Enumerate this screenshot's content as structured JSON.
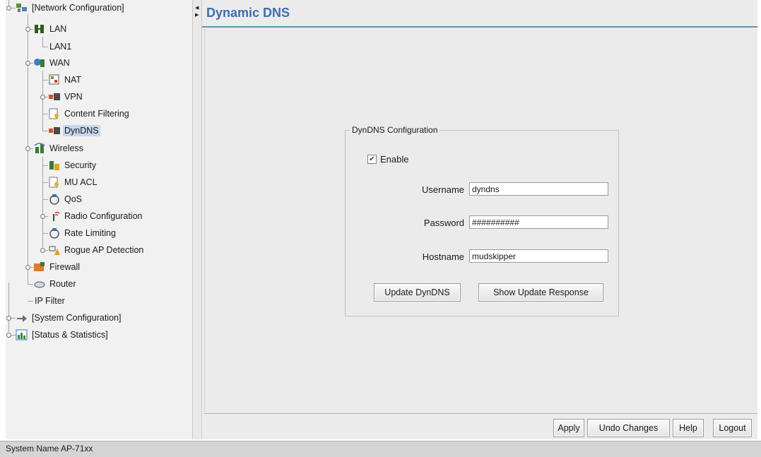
{
  "tree": {
    "items": [
      {
        "label": "[Network Configuration]",
        "icon": "network-config-icon"
      },
      {
        "label": "LAN",
        "icon": "lan-icon"
      },
      {
        "label": "LAN1",
        "icon": ""
      },
      {
        "label": "WAN",
        "icon": "wan-icon"
      },
      {
        "label": "NAT",
        "icon": "nat-icon"
      },
      {
        "label": "VPN",
        "icon": "vpn-icon"
      },
      {
        "label": "Content Filtering",
        "icon": "content-filtering-icon"
      },
      {
        "label": "DynDNS",
        "icon": "dyndns-icon"
      },
      {
        "label": "Wireless",
        "icon": "wireless-icon"
      },
      {
        "label": "Security",
        "icon": "security-icon"
      },
      {
        "label": "MU ACL",
        "icon": "mu-acl-icon"
      },
      {
        "label": "QoS",
        "icon": "qos-icon"
      },
      {
        "label": "Radio Configuration",
        "icon": "radio-config-icon"
      },
      {
        "label": "Rate Limiting",
        "icon": "rate-limiting-icon"
      },
      {
        "label": "Rogue AP Detection",
        "icon": "rogue-ap-icon"
      },
      {
        "label": "Firewall",
        "icon": "firewall-icon"
      },
      {
        "label": "Router",
        "icon": "router-icon"
      },
      {
        "label": "IP Filter",
        "icon": ""
      },
      {
        "label": "[System Configuration]",
        "icon": "system-config-icon"
      },
      {
        "label": "[Status & Statistics]",
        "icon": "status-stats-icon"
      }
    ],
    "selected": "DynDNS"
  },
  "content": {
    "title": "Dynamic DNS",
    "group_title": "DynDNS Configuration",
    "enable_label": "Enable",
    "enable_checked": true,
    "fields": {
      "username": {
        "label": "Username",
        "value": "dyndns"
      },
      "password": {
        "label": "Password",
        "value": "##########"
      },
      "hostname": {
        "label": "Hostname",
        "value": "mudskipper"
      }
    },
    "update_button": "Update DynDNS",
    "show_response_button": "Show Update Response"
  },
  "footer": {
    "apply": "Apply",
    "undo": "Undo Changes",
    "help": "Help",
    "logout": "Logout"
  },
  "status_bar": {
    "text": "System Name AP-71xx"
  },
  "colors": {
    "title": "#3c6fb0",
    "title_rule": "#5b95b3",
    "selection": "#c6d7ee"
  }
}
